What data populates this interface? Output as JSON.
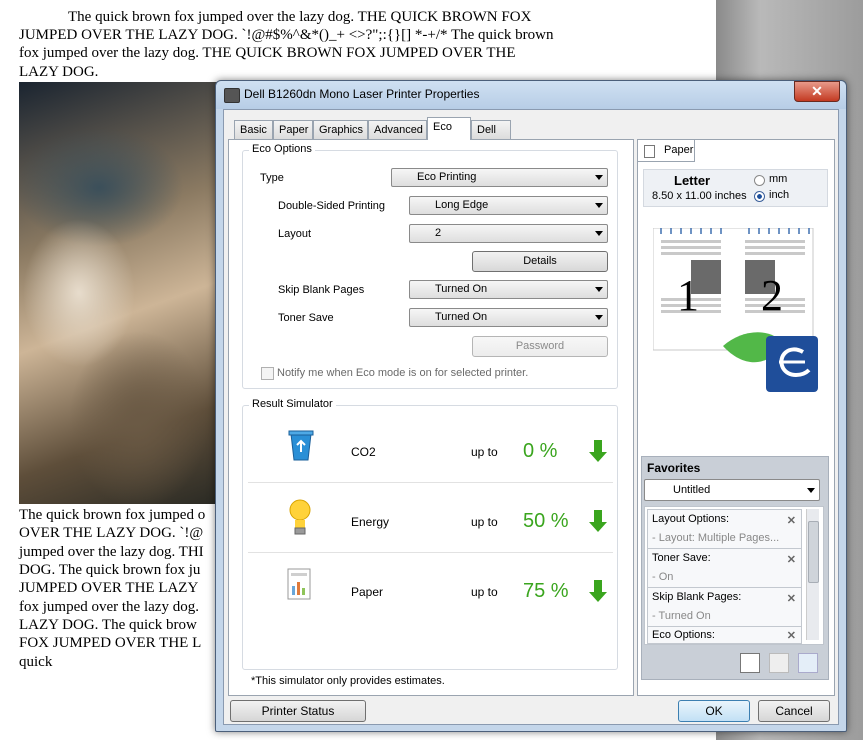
{
  "document": {
    "lines": [
      "The quick brown fox jumped over the lazy dog. THE QUICK BROWN FOX",
      "JUMPED OVER THE LAZY DOG. `!@#$%^&*()_+ <>?\";:{}[] *-+/* The quick brown",
      "fox jumped over the lazy dog. THE QUICK BROWN FOX JUMPED OVER THE",
      "LAZY DOG.",
      "The quick brown fox jumped o",
      "OVER THE LAZY DOG. `!@",
      "jumped over the lazy dog. THI",
      "DOG. The quick brown fox ju",
      "JUMPED OVER THE LAZY",
      "fox jumped over the lazy dog.",
      "LAZY DOG. The quick brow",
      "FOX JUMPED OVER THE L",
      "quick"
    ]
  },
  "dialog": {
    "title": "Dell B1260dn Mono Laser Printer Properties",
    "close_label": "✕",
    "tabs": [
      "Basic",
      "Paper",
      "Graphics",
      "Advanced",
      "Eco",
      "Dell"
    ],
    "active_tab": "Eco",
    "eco_options": {
      "legend": "Eco Options",
      "type_label": "Type",
      "type_value": "Eco Printing",
      "double_sided_label": "Double-Sided Printing",
      "double_sided_value": "Long Edge",
      "layout_label": "Layout",
      "layout_value": "2",
      "details_button": "Details",
      "skip_blank_label": "Skip Blank Pages",
      "skip_blank_value": "Turned On",
      "toner_save_label": "Toner Save",
      "toner_save_value": "Turned On",
      "password_button": "Password",
      "notify_label": "Notify me when Eco mode is on for selected printer."
    },
    "result_simulator": {
      "legend": "Result Simulator",
      "rows": [
        {
          "label": "CO2",
          "upto": "up to",
          "value": "0 %"
        },
        {
          "label": "Energy",
          "upto": "up to",
          "value": "50 %"
        },
        {
          "label": "Paper",
          "upto": "up to",
          "value": "75 %"
        }
      ],
      "note": "*This simulator only provides estimates."
    },
    "preview": {
      "tab_label": "Paper",
      "paper_name": "Letter",
      "paper_size": "8.50 x 11.00 inches",
      "unit_mm": "mm",
      "unit_inch": "inch",
      "selected_unit": "inch",
      "page_numbers": [
        "1",
        "2"
      ]
    },
    "favorites": {
      "title": "Favorites",
      "selected": "Untitled",
      "items": [
        {
          "name": "Layout Options:",
          "value": "- Layout: Multiple Pages..."
        },
        {
          "name": "Toner Save:",
          "value": "- On"
        },
        {
          "name": "Skip Blank Pages:",
          "value": "- Turned On"
        },
        {
          "name": "Eco Options:",
          "value": ""
        }
      ]
    },
    "buttons": {
      "printer_status": "Printer Status",
      "ok": "OK",
      "cancel": "Cancel"
    }
  },
  "colors": {
    "accent_green": "#3aa51e",
    "dialog_frame": "#c4d6ea"
  }
}
